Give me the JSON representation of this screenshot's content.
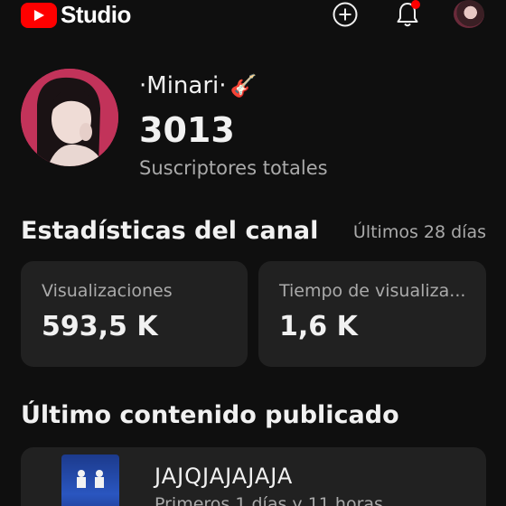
{
  "header": {
    "app_name": "Studio",
    "icons": [
      "youtube-logo-icon",
      "create-icon",
      "bell-icon",
      "avatar"
    ]
  },
  "channel": {
    "name": "·Minari·",
    "name_emoji": "🎸",
    "subscribers": "3013",
    "subscribers_label": "Suscriptores totales"
  },
  "stats": {
    "title": "Estadísticas del canal",
    "period": "Últimos 28 días",
    "cards": [
      {
        "label": "Visualizaciones",
        "value": "593,5 K"
      },
      {
        "label": "Tiempo de visualiza...",
        "value": "1,6 K"
      }
    ]
  },
  "latest": {
    "title": "Último contenido publicado",
    "video_title": "JAJQJAJAJAJA",
    "video_subtitle": "Primeros 1 días y 11 horas"
  },
  "colors": {
    "background": "#0f0f0f",
    "card": "#212121",
    "accent": "#ff0000",
    "secondary_text": "#aaaaaa"
  }
}
